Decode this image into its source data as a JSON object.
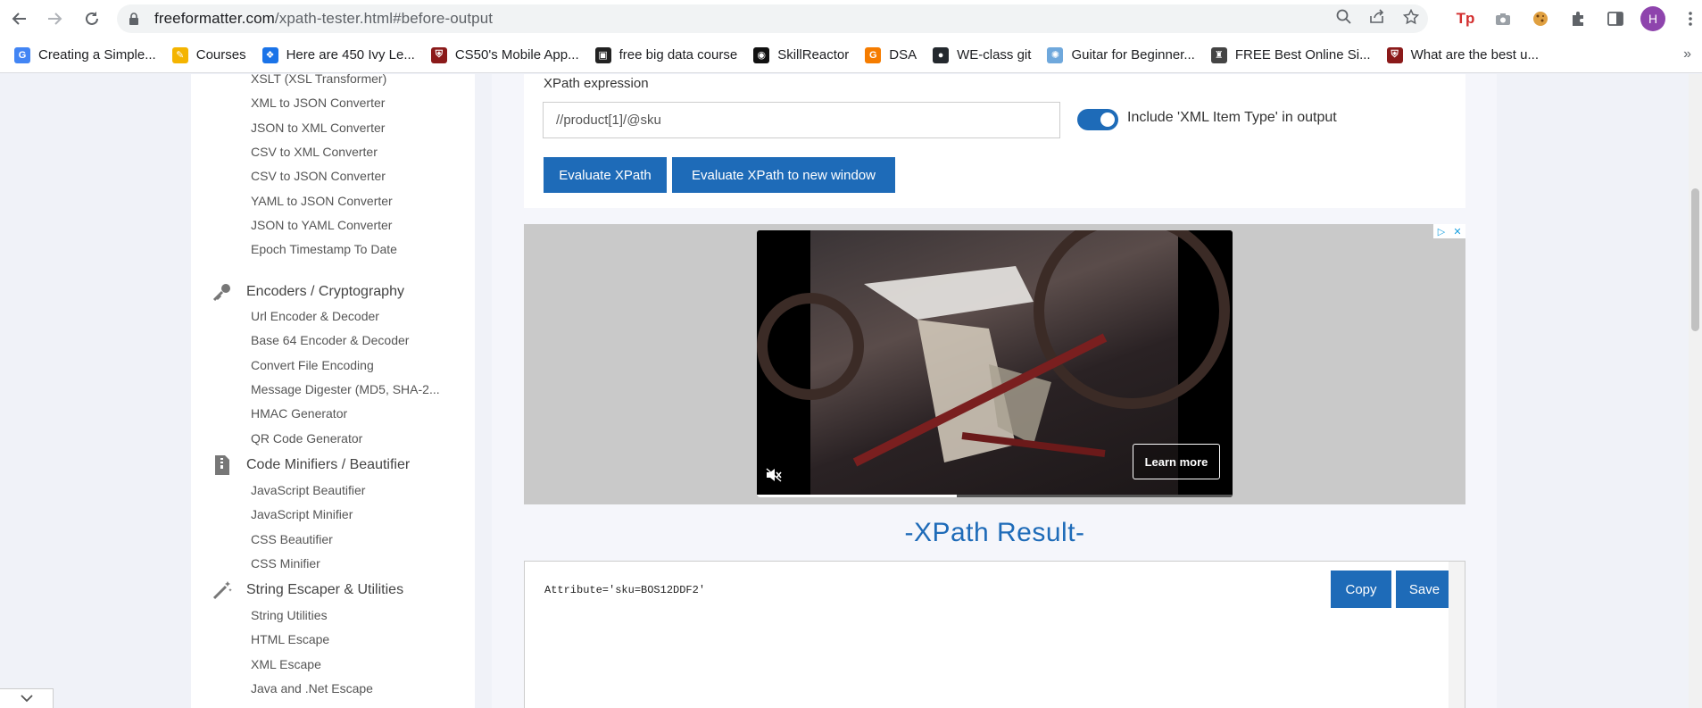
{
  "browser": {
    "url_host": "freeformatter.com",
    "url_path": "/xpath-tester.html#before-output",
    "avatar_letter": "H",
    "bookmarks": [
      {
        "label": "Creating a Simple...",
        "color": "#4285f4",
        "glyph": "G"
      },
      {
        "label": "Courses",
        "color": "#f4b400",
        "glyph": "✎"
      },
      {
        "label": "Here are 450 Ivy Le...",
        "color": "#1a73e8",
        "glyph": "❖"
      },
      {
        "label": "CS50's Mobile App...",
        "color": "#8b1a1a",
        "glyph": "⛨"
      },
      {
        "label": "free big data course",
        "color": "#222222",
        "glyph": "▣"
      },
      {
        "label": "SkillReactor",
        "color": "#111111",
        "glyph": "◉"
      },
      {
        "label": "DSA",
        "color": "#f57c00",
        "glyph": "G"
      },
      {
        "label": "WE-class git",
        "color": "#24292e",
        "glyph": "●"
      },
      {
        "label": "Guitar for Beginner...",
        "color": "#6fa8dc",
        "glyph": "✺"
      },
      {
        "label": "FREE Best Online Si...",
        "color": "#444444",
        "glyph": "♜"
      },
      {
        "label": "What are the best u...",
        "color": "#8b1a1a",
        "glyph": "⛨"
      }
    ]
  },
  "sidebar": {
    "links_top": [
      "XSLT (XSL Transformer)",
      "XML to JSON Converter",
      "JSON to XML Converter",
      "CSV to XML Converter",
      "CSV to JSON Converter",
      "YAML to JSON Converter",
      "JSON to YAML Converter",
      "Epoch Timestamp To Date"
    ],
    "section_encoders": "Encoders / Cryptography",
    "links_encoders": [
      "Url Encoder & Decoder",
      "Base 64 Encoder & Decoder",
      "Convert File Encoding",
      "Message Digester (MD5, SHA-2...",
      "HMAC Generator",
      "QR Code Generator"
    ],
    "section_minifiers": "Code Minifiers / Beautifier",
    "links_minifiers": [
      "JavaScript Beautifier",
      "JavaScript Minifier",
      "CSS Beautifier",
      "CSS Minifier"
    ],
    "section_strings": "String Escaper & Utilities",
    "links_strings": [
      "String Utilities",
      "HTML Escape",
      "XML Escape",
      "Java and .Net Escape"
    ]
  },
  "form": {
    "xpath_label": "XPath expression",
    "xpath_value": "//product[1]/@sku",
    "include_toggle_on": true,
    "include_label": "Include 'XML Item Type' in output",
    "evaluate_label": "Evaluate XPath",
    "evaluate_new_window_label": "Evaluate XPath to new window"
  },
  "ad": {
    "learn_more_label": "Learn more",
    "progress": 0.42
  },
  "result": {
    "title": "-XPath Result-",
    "text": "Attribute='sku=BOS12DDF2'",
    "copy_label": "Copy",
    "save_label": "Save"
  },
  "colors": {
    "accent": "#1e6bb8"
  }
}
